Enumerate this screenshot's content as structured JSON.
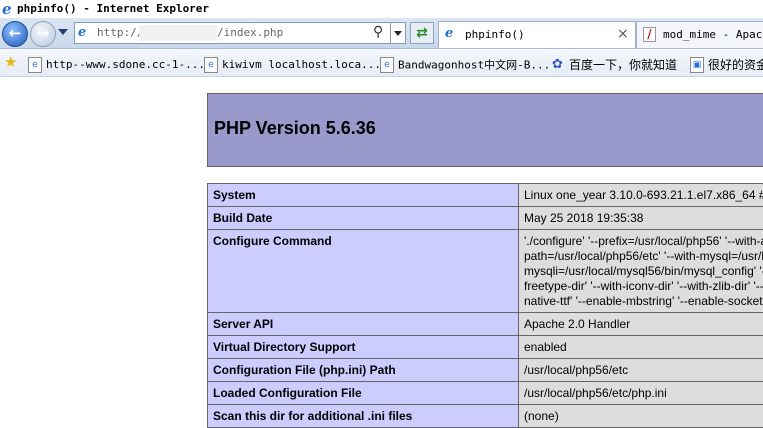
{
  "window": {
    "title": "phpinfo() - Internet Explorer"
  },
  "nav": {
    "url_prefix": "http://",
    "url_suffix": "/index.php",
    "tabs": [
      {
        "label": "phpinfo()",
        "active": true
      },
      {
        "label": "mod_mime - Apache",
        "active": false
      }
    ]
  },
  "favorites": [
    {
      "label": "http--www.sdone.cc-1-..."
    },
    {
      "label": "kiwivm localhost.loca..."
    },
    {
      "label": "Bandwagonhost中文网-B..."
    },
    {
      "label": "百度一下，你就知道"
    },
    {
      "label": "很好的资金"
    }
  ],
  "php": {
    "heading": "PHP Version 5.6.36",
    "rows": [
      {
        "key": "System",
        "value": [
          "Linux one_year 3.10.0-693.21.1.el7.x86_64 #"
        ]
      },
      {
        "key": "Build Date",
        "value": [
          "May 25 2018 19:35:38"
        ]
      },
      {
        "key": "Configure Command",
        "value": [
          "'./configure' '--prefix=/usr/local/php56' '--with-a",
          "path=/usr/local/php56/etc' '--with-mysql=/usr/l",
          "mysqli=/usr/local/mysql56/bin/mysql_config' '-",
          "freetype-dir' '--with-iconv-dir' '--with-zlib-dir' '--",
          "native-ttf' '--enable-mbstring' '--enable-socket"
        ]
      },
      {
        "key": "Server API",
        "value": [
          "Apache 2.0 Handler"
        ]
      },
      {
        "key": "Virtual Directory Support",
        "value": [
          "enabled"
        ]
      },
      {
        "key": "Configuration File (php.ini) Path",
        "value": [
          "/usr/local/php56/etc"
        ]
      },
      {
        "key": "Loaded Configuration File",
        "value": [
          "/usr/local/php56/etc/php.ini"
        ]
      },
      {
        "key": "Scan this dir for additional .ini files",
        "value": [
          "(none)"
        ]
      }
    ]
  },
  "colors": {
    "header_bg": "#9999cc",
    "key_bg": "#ccccff",
    "value_bg": "#dddddd"
  }
}
